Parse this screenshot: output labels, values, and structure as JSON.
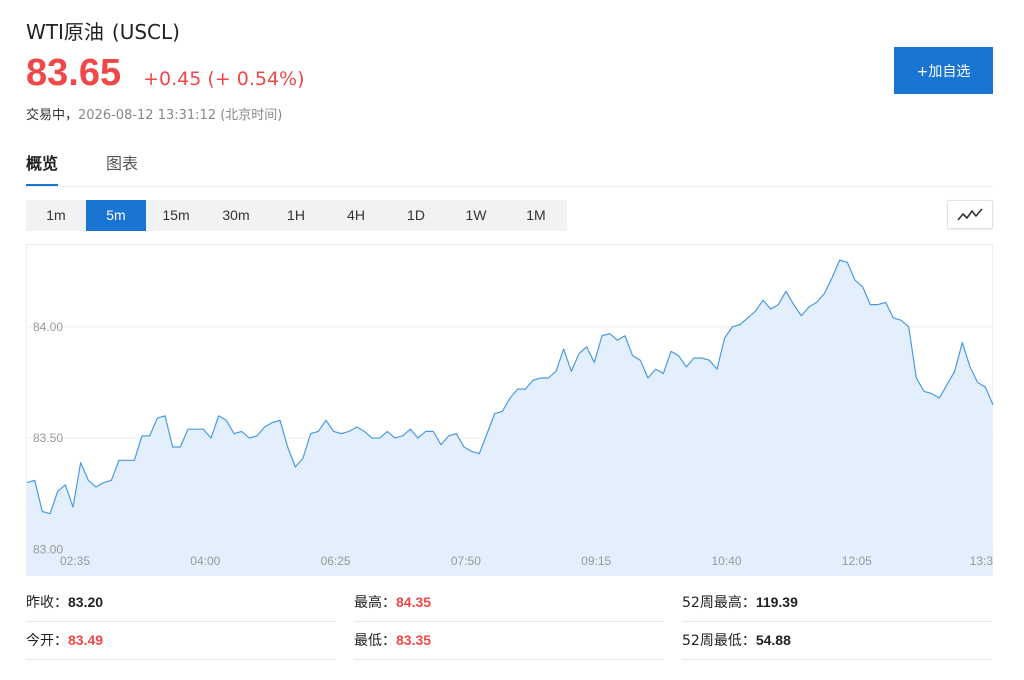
{
  "quote": {
    "name": "WTI原油",
    "code": "(USCL)",
    "price": "83.65",
    "change": "+0.45",
    "change_pct": "(+ 0.54%)",
    "status": "交易中，",
    "timestamp": "2026-08-12 13:31:12",
    "timezone": "(北京时间)"
  },
  "actions": {
    "add_watchlist": "+加自选"
  },
  "tabs": [
    {
      "label": "概览",
      "active": true
    },
    {
      "label": "图表",
      "active": false
    }
  ],
  "intervals": {
    "items": [
      "1m",
      "5m",
      "15m",
      "30m",
      "1H",
      "4H",
      "1D",
      "1W",
      "1M"
    ],
    "selected": "5m"
  },
  "chart_type_icon": "line-chart-icon",
  "colors": {
    "up": "#f04848",
    "accent": "#1a75d2",
    "line": "#4a9be0",
    "fill": "#e3effc"
  },
  "chart_data": {
    "type": "area",
    "y_ticks": [
      "84.00",
      "83.50",
      "83.00"
    ],
    "x_ticks": [
      "02:35",
      "04:00",
      "06:25",
      "07:50",
      "09:15",
      "10:40",
      "12:05",
      "13:3"
    ],
    "ylim": [
      82.88,
      84.35
    ],
    "grid": "horizontal",
    "legend": "none",
    "values": [
      83.3,
      83.31,
      83.17,
      83.16,
      83.26,
      83.29,
      83.19,
      83.39,
      83.31,
      83.28,
      83.3,
      83.31,
      83.4,
      83.4,
      83.4,
      83.51,
      83.51,
      83.59,
      83.6,
      83.46,
      83.46,
      83.54,
      83.54,
      83.54,
      83.5,
      83.6,
      83.58,
      83.52,
      83.53,
      83.5,
      83.51,
      83.55,
      83.57,
      83.58,
      83.46,
      83.37,
      83.41,
      83.52,
      83.53,
      83.58,
      83.53,
      83.52,
      83.53,
      83.55,
      83.53,
      83.5,
      83.5,
      83.53,
      83.5,
      83.51,
      83.54,
      83.5,
      83.53,
      83.53,
      83.47,
      83.51,
      83.52,
      83.46,
      83.44,
      83.43,
      83.52,
      83.61,
      83.62,
      83.68,
      83.72,
      83.72,
      83.76,
      83.77,
      83.77,
      83.8,
      83.9,
      83.8,
      83.88,
      83.91,
      83.84,
      83.96,
      83.97,
      83.94,
      83.96,
      83.87,
      83.85,
      83.77,
      83.81,
      83.79,
      83.89,
      83.87,
      83.82,
      83.86,
      83.86,
      83.85,
      83.81,
      83.95,
      84.0,
      84.01,
      84.04,
      84.07,
      84.12,
      84.08,
      84.1,
      84.16,
      84.1,
      84.05,
      84.09,
      84.11,
      84.15,
      84.22,
      84.3,
      84.29,
      84.21,
      84.18,
      84.1,
      84.1,
      84.11,
      84.04,
      84.03,
      84.0,
      83.77,
      83.71,
      83.7,
      83.68,
      83.74,
      83.8,
      83.93,
      83.82,
      83.75,
      83.73,
      83.65
    ]
  },
  "stats": [
    {
      "label": "昨收：",
      "value": "83.20",
      "tone": "dark"
    },
    {
      "label": "最高：",
      "value": "84.35",
      "tone": "red"
    },
    {
      "label": "52周最高：",
      "value": "119.39",
      "tone": "dark"
    },
    {
      "label": "今开：",
      "value": "83.49",
      "tone": "red"
    },
    {
      "label": "最低：",
      "value": "83.35",
      "tone": "red"
    },
    {
      "label": "52周最低：",
      "value": "54.88",
      "tone": "dark"
    }
  ]
}
